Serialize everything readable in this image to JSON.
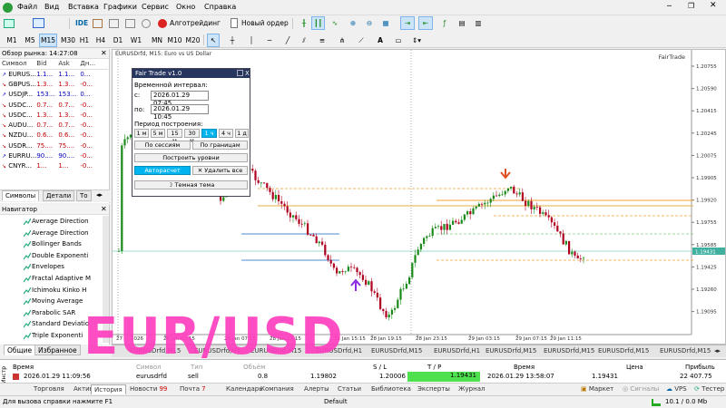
{
  "menu": [
    "Файл",
    "Вид",
    "Вставка",
    "Графики",
    "Сервис",
    "Окно",
    "Справка"
  ],
  "toolbar": {
    "ide_label": "IDE",
    "algo_label": "Алготрейдинг",
    "new_order_label": "Новый ордер"
  },
  "timeframes": [
    "M1",
    "M5",
    "M15",
    "M30",
    "H1",
    "H4",
    "D1",
    "W1",
    "MN",
    "M10",
    "M20"
  ],
  "selected_timeframe": "M15",
  "market_watch": {
    "title": "Обзор рынка: 14:27:08",
    "columns": [
      "Символ",
      "Bid",
      "Ask",
      "Дн..."
    ],
    "rows": [
      {
        "symbol": "EURUS...",
        "bid": "1.1...",
        "ask": "1.1...",
        "day": "0...",
        "dir": "up"
      },
      {
        "symbol": "GBPUS...",
        "bid": "1.3...",
        "ask": "1.3...",
        "day": "-0...",
        "dir": "down"
      },
      {
        "symbol": "USDJP...",
        "bid": "153...",
        "ask": "153...",
        "day": "0...",
        "dir": "up"
      },
      {
        "symbol": "USDC...",
        "bid": "0.7...",
        "ask": "0.7...",
        "day": "-0...",
        "dir": "down"
      },
      {
        "symbol": "USDC...",
        "bid": "1.3...",
        "ask": "1.3...",
        "day": "-0...",
        "dir": "down"
      },
      {
        "symbol": "AUDU...",
        "bid": "0.7...",
        "ask": "0.7...",
        "day": "-0...",
        "dir": "down"
      },
      {
        "symbol": "NZDU...",
        "bid": "0.6...",
        "ask": "0.6...",
        "day": "-0...",
        "dir": "down"
      },
      {
        "symbol": "USDR...",
        "bid": "75....",
        "ask": "75....",
        "day": "-0...",
        "dir": "down"
      },
      {
        "symbol": "EURRU...",
        "bid": "90....",
        "ask": "90....",
        "day": "-0...",
        "dir": "up"
      },
      {
        "symbol": "CNYR...",
        "bid": "1...",
        "ask": "1...",
        "day": "-0...",
        "dir": "down"
      }
    ],
    "tabs": [
      "Символы",
      "Детали",
      "То"
    ]
  },
  "navigator": {
    "title": "Навигатор",
    "items": [
      "Average Direction",
      "Average Direction",
      "Bollinger Bands",
      "Double Exponenti",
      "Envelopes",
      "Fractal Adaptive M",
      "Ichimoku Kinko H",
      "Moving Average",
      "Parabolic SAR",
      "Standard Deviatio",
      "Triple Exponenti"
    ],
    "tabs": [
      "Общие",
      "Избранное"
    ]
  },
  "chart": {
    "title": "EURUSDrfd, M15:  Euro vs US Dollar",
    "indicator_label": "FairTrade",
    "current_price": "1.19431",
    "price_ticks": [
      "1.20755",
      "1.20590",
      "1.20415",
      "1.20245",
      "1.20075",
      "1.19905",
      "1.19920",
      "1.19755",
      "1.19585",
      "1.19425",
      "1.19260",
      "1.19095"
    ],
    "time_ticks": [
      "27 ...",
      "2026",
      "28 Jan 03:15",
      "28 Jan 07:15",
      "28 Jan 11:15",
      "28 Jan 15:15",
      "28 Jan 19:15",
      "28 Jan 23:15",
      "29 Jan 03:15",
      "29 Jan 07:15",
      "29 Jan 11:15"
    ]
  },
  "panel": {
    "title": "Fair Trade v1.0",
    "interval_label": "Временной интервал:",
    "from_label": "с:",
    "from_value": "2026.01.29 07:45",
    "to_label": "по:",
    "to_value": "2026.01.29 10:45",
    "period_label": "Период построения:",
    "periods": [
      "1 м",
      "5 м",
      "15 м",
      "30 м",
      "1 ч",
      "4 ч",
      "1 д"
    ],
    "active_period": "1 ч",
    "by_sessions": "По сессиям",
    "by_bounds": "По границам",
    "build_levels": "Построить уровни",
    "auto_calc": "Авторасчет",
    "delete_all": "Удалить все",
    "dark_theme": "Темная тема"
  },
  "chart_tabs": [
    "EURUSDrfd,M15",
    "EURUSDrfd,H1",
    "EURUSDrfd,M15",
    "EURUSDrfd,H1",
    "EURUSDrfd,M15",
    "EURUSDrfd,H1",
    "EURUSDrfd,M15",
    "EURUSDrfd,M15"
  ],
  "history": {
    "columns": [
      "Время",
      "Символ",
      "Тип",
      "Объём",
      "S / L",
      "T / P",
      "Время",
      "Цена",
      "Прибыль"
    ],
    "row": {
      "time": "2026.01.29 11:09:56",
      "symbol": "eurusdrfd",
      "type": "sell",
      "volume": "0.8",
      "sl": "1.19802",
      "tp1": "1.20006",
      "tp2": "1.19431",
      "close_time": "2026.01.29 13:58:07",
      "price": "1.19431",
      "profit": "22 407.75"
    }
  },
  "terminal_tabs": [
    "Торговля",
    "Активы",
    "История",
    "Новости",
    "Почта",
    "Календарь",
    "Компания",
    "Алерты",
    "Статьи",
    "Библиотека",
    "Эксперты",
    "Журнал"
  ],
  "news_badge": "99",
  "mail_badge": "7",
  "terminal_right": {
    "market": "Маркет",
    "signals": "Сигналы",
    "vps": "VPS",
    "tester": "Тестер"
  },
  "status": {
    "help": "Для вызова справки нажмите F1",
    "profile": "Default",
    "traffic": "10.1 / 0.0 Mb"
  },
  "overlay_text": "EUR/USD",
  "colors": {
    "overlay": "#ff3fbf",
    "bull": "#1a8a1a",
    "bear": "#b00020",
    "panel_title": "#26365f",
    "accent": "#00b4f0"
  }
}
